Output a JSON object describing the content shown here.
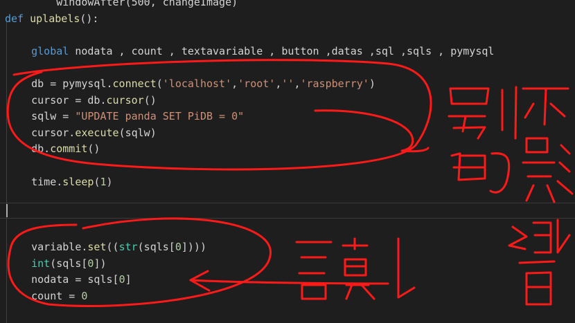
{
  "editor": {
    "lines": [
      [
        {
          "t": "        windowAfter(500, changeImage)",
          "c": "plain"
        }
      ],
      [
        {
          "t": "def ",
          "c": "kw"
        },
        {
          "t": "uplabels",
          "c": "fn"
        },
        {
          "t": "():",
          "c": "plain"
        }
      ],
      [],
      [
        {
          "t": "    ",
          "c": "plain"
        },
        {
          "t": "global ",
          "c": "kw"
        },
        {
          "t": "nodata , count , textavariable , button ,datas ,sql ,sqls , pymysql",
          "c": "plain"
        }
      ],
      [],
      [
        {
          "t": "    db = pymysql.",
          "c": "plain"
        },
        {
          "t": "connect",
          "c": "fn"
        },
        {
          "t": "(",
          "c": "plain"
        },
        {
          "t": "'localhost'",
          "c": "str"
        },
        {
          "t": ",",
          "c": "plain"
        },
        {
          "t": "'root'",
          "c": "str"
        },
        {
          "t": ",",
          "c": "plain"
        },
        {
          "t": "''",
          "c": "str"
        },
        {
          "t": ",",
          "c": "plain"
        },
        {
          "t": "'raspberry'",
          "c": "str"
        },
        {
          "t": ")",
          "c": "plain"
        }
      ],
      [
        {
          "t": "    cursor = db.",
          "c": "plain"
        },
        {
          "t": "cursor",
          "c": "fn"
        },
        {
          "t": "()",
          "c": "plain"
        }
      ],
      [
        {
          "t": "    sqlw = ",
          "c": "plain"
        },
        {
          "t": "\"UPDATE panda SET PiDB = 0\"",
          "c": "str"
        }
      ],
      [
        {
          "t": "    cursor.",
          "c": "plain"
        },
        {
          "t": "execute",
          "c": "fn"
        },
        {
          "t": "(sqlw)",
          "c": "plain"
        }
      ],
      [
        {
          "t": "    db.",
          "c": "plain"
        },
        {
          "t": "commit",
          "c": "fn"
        },
        {
          "t": "()",
          "c": "plain"
        }
      ],
      [],
      [
        {
          "t": "    time.",
          "c": "plain"
        },
        {
          "t": "sleep",
          "c": "fn"
        },
        {
          "t": "(",
          "c": "plain"
        },
        {
          "t": "1",
          "c": "num"
        },
        {
          "t": ")",
          "c": "plain"
        }
      ],
      [],
      [],
      [],
      [
        {
          "t": "    variable.",
          "c": "plain"
        },
        {
          "t": "set",
          "c": "fn"
        },
        {
          "t": "((",
          "c": "plain"
        },
        {
          "t": "str",
          "c": "bi"
        },
        {
          "t": "(sqls[",
          "c": "plain"
        },
        {
          "t": "0",
          "c": "num"
        },
        {
          "t": "])))",
          "c": "plain"
        }
      ],
      [
        {
          "t": "    ",
          "c": "plain"
        },
        {
          "t": "int",
          "c": "bi"
        },
        {
          "t": "(sqls[",
          "c": "plain"
        },
        {
          "t": "0",
          "c": "num"
        },
        {
          "t": "])",
          "c": "plain"
        }
      ],
      [
        {
          "t": "    nodata = sqls[",
          "c": "plain"
        },
        {
          "t": "0",
          "c": "num"
        },
        {
          "t": "]",
          "c": "plain"
        }
      ],
      [
        {
          "t": "    count = ",
          "c": "plain"
        },
        {
          "t": "0",
          "c": "num"
        }
      ]
    ]
  },
  "annotations": {
    "text_1": "另的",
    "text_2": "別",
    "text_3": "不影響",
    "text_4": "讀"
  },
  "colors": {
    "background": "#1e1e1e",
    "annotation": "#ff1a1a"
  }
}
